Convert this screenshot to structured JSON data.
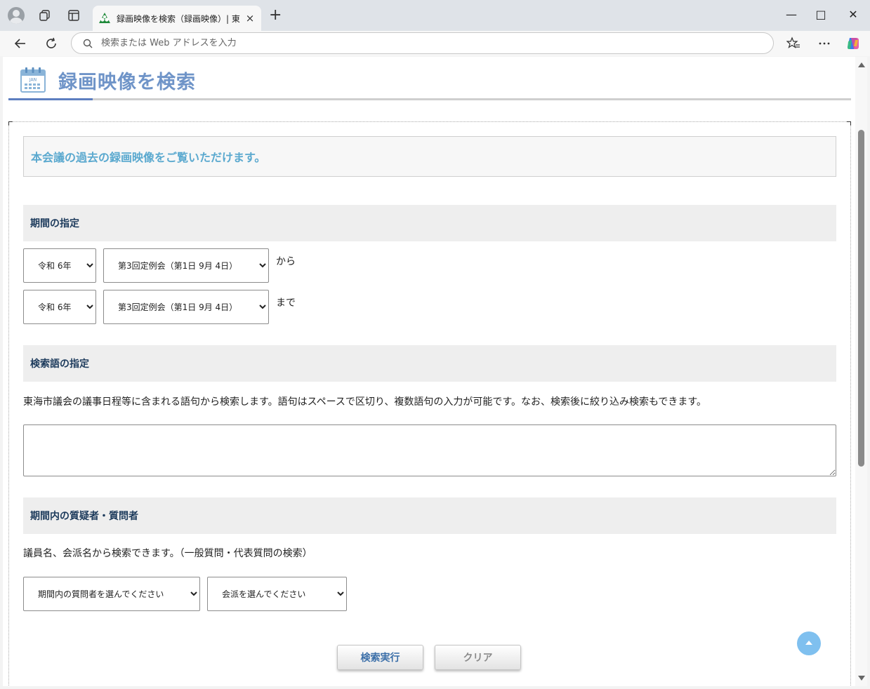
{
  "browser": {
    "tab_title": "録画映像を検索（録画映像）| 東海市議会",
    "tab_close": "×",
    "new_tab": "+",
    "address_placeholder": "検索または Web アドレスを入力",
    "window": {
      "minimize": "—",
      "maximize": "□",
      "close": "✕"
    }
  },
  "page": {
    "title": "録画映像を検索",
    "calendar_label": "JAN",
    "intro": "本会議の過去の録画映像をご覧いただけます。",
    "period": {
      "heading": "期間の指定",
      "from": {
        "year": "令和 6年",
        "session": "第3回定例会（第1日 9月 4日）",
        "suffix": "から"
      },
      "to": {
        "year": "令和 6年",
        "session": "第3回定例会（第1日 9月 4日）",
        "suffix": "まで"
      }
    },
    "keyword": {
      "heading": "検索語の指定",
      "description": "東海市議会の議事日程等に含まれる語句から検索します。語句はスペースで区切り、複数語句の入力が可能です。なお、検索後に絞り込み検索もできます。",
      "value": ""
    },
    "questioner": {
      "heading": "期間内の質疑者・質問者",
      "description": "議員名、会派名から検索できます。（一般質問・代表質問の検索）",
      "member_select": "期間内の質問者を選んでください",
      "faction_select": "会派を選んでください"
    },
    "buttons": {
      "search": "検索実行",
      "clear": "クリア"
    }
  },
  "colors": {
    "title": "#6f94c8",
    "intro_text": "#5ba9cf",
    "section_text": "#1d3b5c",
    "accent_line": "#5d7ec0",
    "to_top": "#7fc0ef"
  }
}
